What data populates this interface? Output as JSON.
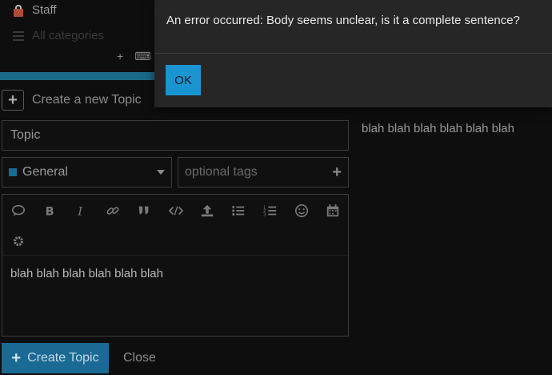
{
  "sidebar": {
    "staff_label": "Staff",
    "all_categories_label": "All categories"
  },
  "top_tools": {
    "plus_glyph": "+",
    "keyboard_glyph": "⌨"
  },
  "create_new_topic": {
    "label": "Create a new Topic"
  },
  "modal": {
    "message": "An error occurred: Body seems unclear, is it a complete sentence?",
    "ok_label": "OK"
  },
  "composer": {
    "title_value": "Topic",
    "category": {
      "selected": "General",
      "color": "#1a6a94"
    },
    "tags_placeholder": "optional tags",
    "toolbar": [
      "quote-icon",
      "bold-icon",
      "italic-icon",
      "link-icon",
      "blockquote-icon",
      "code-icon",
      "upload-icon",
      "bullet-list-icon",
      "numbered-list-icon",
      "emoji-icon",
      "calendar-icon",
      "gear-icon"
    ],
    "body_text": "blah blah blah blah blah blah",
    "preview_text": "blah blah blah blah blah blah",
    "create_label": "Create Topic",
    "close_label": "Close"
  },
  "colors": {
    "background": "#0e0e0e",
    "modal_bg": "#262626",
    "accent_button": "#1b95d1",
    "primary_button": "#1a6a94"
  }
}
